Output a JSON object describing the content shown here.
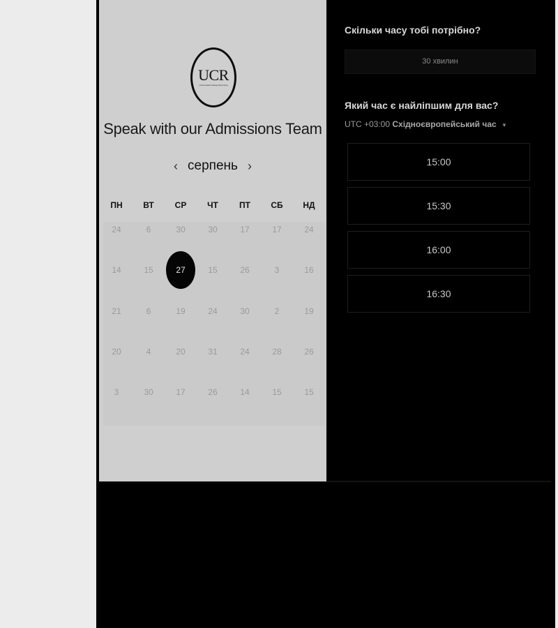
{
  "booking": {
    "logo_text": "UCR",
    "logo_subtext": "Universidad College Recruiting",
    "title": "Speak with our Admissions Team",
    "month": "серпень",
    "prev_icon": "chevron-left-icon",
    "next_icon": "chevron-right-icon",
    "weekdays": [
      "ПН",
      "ВТ",
      "СР",
      "ЧТ",
      "ПТ",
      "СБ",
      "НД"
    ],
    "weeks": [
      [
        "24",
        "6",
        "30",
        "30",
        "17",
        "17",
        "24"
      ],
      [
        "14",
        "15",
        "27",
        "15",
        "26",
        "3",
        "16"
      ],
      [
        "21",
        "6",
        "19",
        "24",
        "30",
        "2",
        "19"
      ],
      [
        "20",
        "4",
        "20",
        "31",
        "24",
        "28",
        "26"
      ],
      [
        "3",
        "30",
        "17",
        "26",
        "14",
        "15",
        "15"
      ]
    ],
    "selected_day": "27"
  },
  "scheduler": {
    "duration_heading": "Скільки часу тобі потрібно?",
    "duration_value": "30 хвилин",
    "time_heading": "Який час є найліпшим для вас?",
    "timezone_offset": "UTC +03:00",
    "timezone_name": "Східноєвропейський час",
    "timezone_caret_icon": "caret-down-icon",
    "slots": [
      "15:00",
      "15:30",
      "16:00",
      "16:30"
    ]
  },
  "colors": {
    "panel_bg": "#cfcfcf",
    "page_bg": "#000000",
    "selected_day_bg": "#050505",
    "gutter_bg": "#ececec"
  }
}
